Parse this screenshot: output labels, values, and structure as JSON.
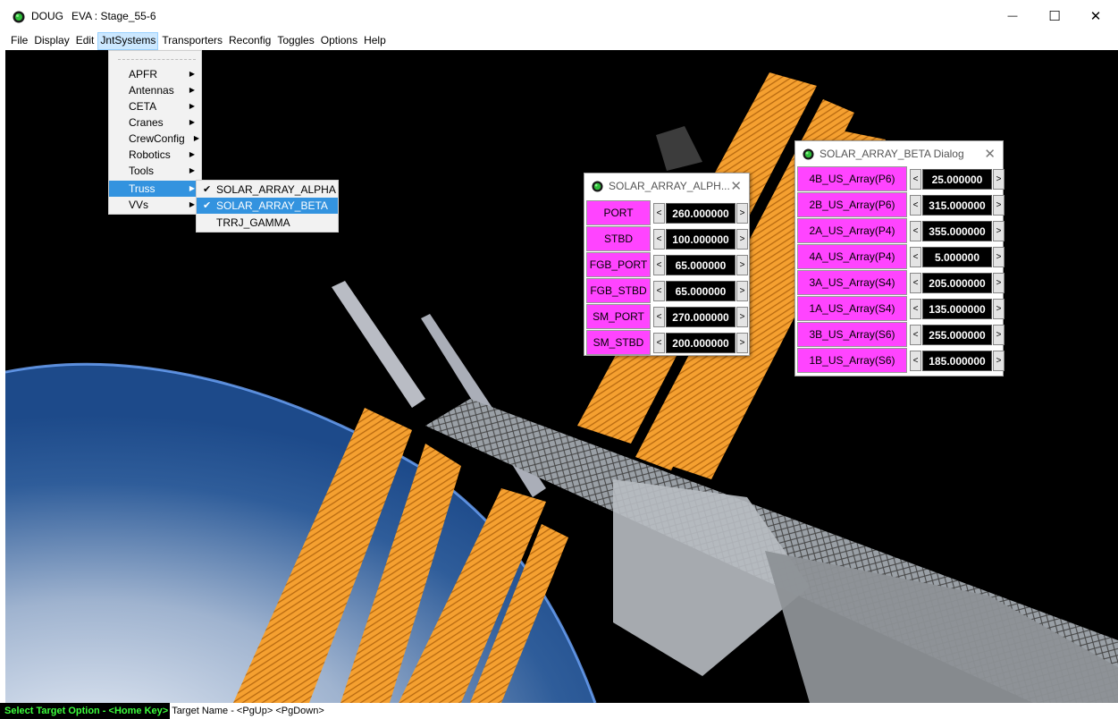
{
  "window": {
    "app_name": "DOUG",
    "doc_title": "EVA : Stage_55-6",
    "minimize_glyph": "—",
    "maximize_glyph": "☐",
    "close_glyph": "✕"
  },
  "menubar": {
    "items": [
      "File",
      "Display",
      "Edit",
      "JntSystems",
      "Transporters",
      "Reconfig",
      "Toggles",
      "Options",
      "Help"
    ],
    "active": "JntSystems"
  },
  "jntsystems_menu": {
    "items": [
      "APFR",
      "Antennas",
      "CETA",
      "Cranes",
      "CrewConfig",
      "Robotics",
      "Tools",
      "Truss",
      "VVs"
    ],
    "highlighted": "Truss",
    "submenu_arrow": "▶"
  },
  "truss_submenu": {
    "items": [
      {
        "label": "SOLAR_ARRAY_ALPHA",
        "checked": true
      },
      {
        "label": "SOLAR_ARRAY_BETA",
        "checked": true
      },
      {
        "label": "TRRJ_GAMMA",
        "checked": false
      }
    ],
    "highlighted": "SOLAR_ARRAY_BETA",
    "check_glyph": "✔"
  },
  "alpha_dialog": {
    "title": "SOLAR_ARRAY_ALPH...",
    "close_glyph": "✕",
    "dec_glyph": "<",
    "inc_glyph": ">",
    "joints": [
      {
        "label": "PORT",
        "value": "260.000000"
      },
      {
        "label": "STBD",
        "value": "100.000000"
      },
      {
        "label": "FGB_PORT",
        "value": "65.000000"
      },
      {
        "label": "FGB_STBD",
        "value": "65.000000"
      },
      {
        "label": "SM_PORT",
        "value": "270.000000"
      },
      {
        "label": "SM_STBD",
        "value": "200.000000"
      }
    ]
  },
  "beta_dialog": {
    "title": "SOLAR_ARRAY_BETA Dialog",
    "close_glyph": "✕",
    "dec_glyph": "<",
    "inc_glyph": ">",
    "joints": [
      {
        "label": "4B_US_Array(P6)",
        "value": "25.000000"
      },
      {
        "label": "2B_US_Array(P6)",
        "value": "315.000000"
      },
      {
        "label": "2A_US_Array(P4)",
        "value": "355.000000"
      },
      {
        "label": "4A_US_Array(P4)",
        "value": "5.000000"
      },
      {
        "label": "3A_US_Array(S4)",
        "value": "205.000000"
      },
      {
        "label": "1A_US_Array(S4)",
        "value": "135.000000"
      },
      {
        "label": "3B_US_Array(S6)",
        "value": "255.000000"
      },
      {
        "label": "1B_US_Array(S6)",
        "value": "185.000000"
      }
    ]
  },
  "statusbar": {
    "hint": "Select Target Option - <Home Key>",
    "target": "Target Name - <PgUp> <PgDown>"
  },
  "colors": {
    "joint_label_bg": "#ff44ff",
    "menu_highlight": "#3393df",
    "status_hint_text": "#3cff3c",
    "solar_panel": "#f5a030"
  }
}
